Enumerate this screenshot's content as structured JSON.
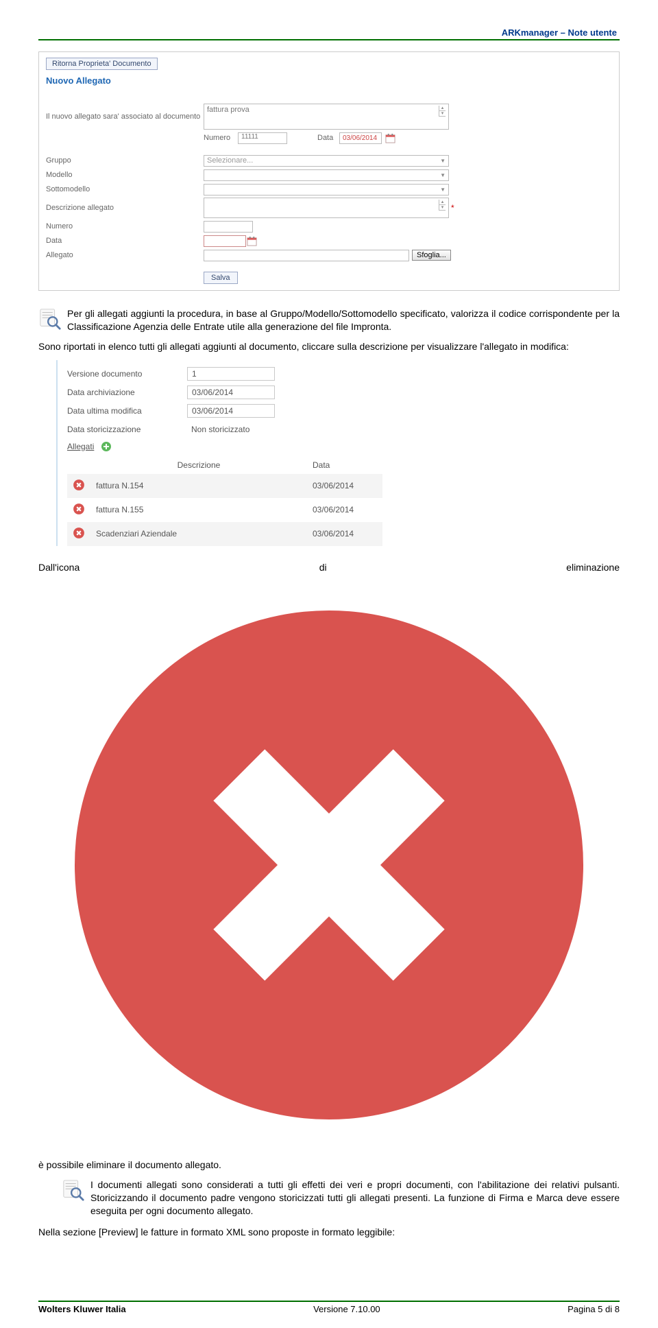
{
  "header": {
    "title": "ARKmanager – Note utente"
  },
  "shot1": {
    "return_btn": "Ritorna Proprieta' Documento",
    "title": "Nuovo Allegato",
    "assoc_label": "Il nuovo allegato sara' associato al documento",
    "assoc_value": "fattura prova",
    "numero_label": "Numero",
    "numero_value": "11111",
    "data_label": "Data",
    "data_value": "03/06/2014",
    "gruppo_label": "Gruppo",
    "gruppo_placeholder": "Selezionare...",
    "modello_label": "Modello",
    "sottomodello_label": "Sottomodello",
    "descr_label": "Descrizione allegato",
    "numero2_label": "Numero",
    "data2_label": "Data",
    "allegato_label": "Allegato",
    "sfoglia": "Sfoglia...",
    "salva": "Salva"
  },
  "body": {
    "p1": "Per gli allegati aggiunti la procedura, in base al Gruppo/Modello/Sottomodello specificato, valorizza il codice corrispondente per la Classificazione Agenzia delle Entrate utile alla generazione del file Impronta.",
    "p2": "Sono riportati in elenco tutti gli allegati aggiunti al documento, cliccare sulla descrizione per visualizzare l'allegato in modifica:"
  },
  "shot2": {
    "versione_k": "Versione documento",
    "versione_v": "1",
    "data_arch_k": "Data archiviazione",
    "data_arch_v": "03/06/2014",
    "data_mod_k": "Data ultima modifica",
    "data_mod_v": "03/06/2014",
    "data_stor_k": "Data storicizzazione",
    "data_stor_v": "Non storicizzato",
    "allegati": "Allegati",
    "th_descr": "Descrizione",
    "th_data": "Data",
    "rows": [
      {
        "descr": "fattura N.154",
        "data": "03/06/2014"
      },
      {
        "descr": "fattura N.155",
        "data": "03/06/2014"
      },
      {
        "descr": "Scadenziari Aziendale",
        "data": "03/06/2014"
      }
    ]
  },
  "body2": {
    "elim_pre": "Dall'icona di eliminazione",
    "elim_post": " è possibile eliminare il documento allegato.",
    "note": "I documenti allegati sono considerati a tutti gli effetti dei veri e propri documenti, con l'abilitazione dei relativi pulsanti. Storicizzando il documento padre vengono storicizzati tutti gli allegati presenti. La funzione di Firma e Marca deve essere eseguita per ogni documento allegato.",
    "preview": "Nella sezione [Preview] le fatture in formato XML sono proposte in formato leggibile:"
  },
  "footer": {
    "left": "Wolters Kluwer Italia",
    "center": "Versione  7.10.00",
    "right": "Pagina  5 di 8"
  }
}
